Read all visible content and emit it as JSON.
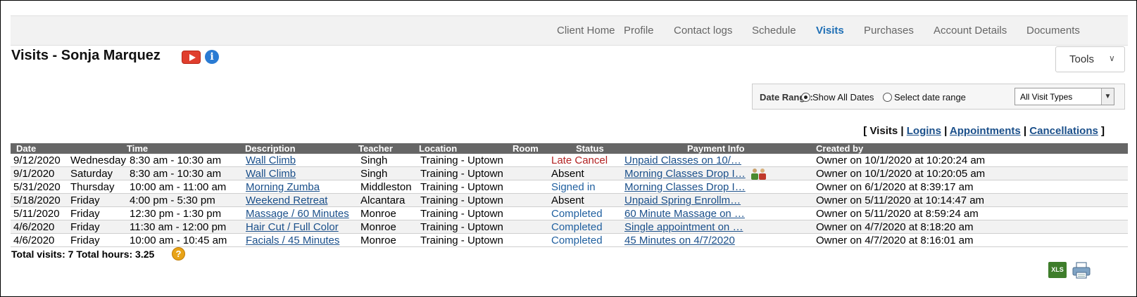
{
  "nav": {
    "tabs": [
      {
        "label": "Client Home"
      },
      {
        "label": "Profile"
      },
      {
        "label": "Contact logs"
      },
      {
        "label": "Schedule"
      },
      {
        "label": "Visits"
      },
      {
        "label": "Purchases"
      },
      {
        "label": "Account Details"
      },
      {
        "label": "Documents"
      }
    ],
    "active": "Visits"
  },
  "page": {
    "title": "Visits - Sonja Marquez",
    "tools_label": "Tools",
    "info_glyph": "i"
  },
  "date_range": {
    "label": "Date Range:",
    "option_all": "Show All Dates",
    "option_select": "Select date range",
    "selected": "Show All Dates",
    "visit_type": "All Visit Types"
  },
  "view_links": {
    "open": "[",
    "visits": "Visits",
    "sep": "|",
    "logins": "Logins",
    "appointments": "Appointments",
    "cancellations": "Cancellations",
    "close": "]"
  },
  "table": {
    "headers": {
      "date": "Date",
      "time": "Time",
      "description": "Description",
      "teacher": "Teacher",
      "location": "Location",
      "room": "Room",
      "status": "Status",
      "payment": "Payment Info",
      "created": "Created by"
    },
    "rows": [
      {
        "date": "9/12/2020",
        "day": "Wednesday",
        "time": "8:30 am  - 10:30 am",
        "description": "Wall Climb",
        "teacher": "Singh",
        "location": "Training - Uptown",
        "room": "",
        "status": "Late Cancel",
        "payment": "Unpaid Classes on 10/…",
        "created": "Owner on 10/1/2020 at 10:20:24 am"
      },
      {
        "date": "9/1/2020",
        "day": "Saturday",
        "time": "8:30 am  - 10:30 am",
        "description": "Wall Climb",
        "teacher": "Singh",
        "location": "Training - Uptown",
        "room": "",
        "status": "Absent",
        "payment": "Morning Classes Drop I…",
        "created": "Owner on 10/1/2020 at 10:20:05 am"
      },
      {
        "date": "5/31/2020",
        "day": "Thursday",
        "time": "10:00 am  - 11:00 am",
        "description": "Morning Zumba",
        "teacher": "Middleston",
        "location": "Training - Uptown",
        "room": "",
        "status": "Signed in",
        "payment": "Morning Classes Drop I…",
        "created": "Owner on 6/1/2020 at 8:39:17 am"
      },
      {
        "date": "5/18/2020",
        "day": "Friday",
        "time": "4:00 pm  - 5:30 pm",
        "description": "Weekend Retreat",
        "teacher": "Alcantara",
        "location": "Training - Uptown",
        "room": "",
        "status": "Absent",
        "payment": "Unpaid Spring Enrollm…",
        "created": "Owner on 5/11/2020 at 10:14:47 am"
      },
      {
        "date": "5/11/2020",
        "day": "Friday",
        "time": "12:30 pm  - 1:30 pm",
        "description": "Massage / 60 Minutes",
        "teacher": "Monroe",
        "location": "Training - Uptown",
        "room": "",
        "status": "Completed",
        "payment": "60 Minute Massage on …",
        "created": "Owner on 5/11/2020 at 8:59:24 am"
      },
      {
        "date": "4/6/2020",
        "day": "Friday",
        "time": "11:30 am  - 12:00 pm",
        "description": "Hair Cut / Full Color",
        "teacher": "Monroe",
        "location": "Training - Uptown",
        "room": "",
        "status": "Completed",
        "payment": "Single appointment on …",
        "created": "Owner on 4/7/2020 at 8:18:20 am"
      },
      {
        "date": "4/6/2020",
        "day": "Friday",
        "time": "10:00 am  - 10:45 am",
        "description": "Facials / 45 Minutes",
        "teacher": "Monroe",
        "location": "Training - Uptown",
        "room": "",
        "status": "Completed",
        "payment": "45 Minutes on 4/7/2020",
        "created": "Owner on 4/7/2020 at 8:16:01 am"
      }
    ]
  },
  "totals": {
    "text": "Total visits: 7  Total hours: 3.25",
    "help_glyph": "?"
  },
  "footer": {
    "xls_label": "XLS"
  },
  "colors": {
    "accent": "#1f6fb5",
    "header_bg": "#666666",
    "late_cancel": "#b22222",
    "status_blue": "#1f5f9f"
  }
}
